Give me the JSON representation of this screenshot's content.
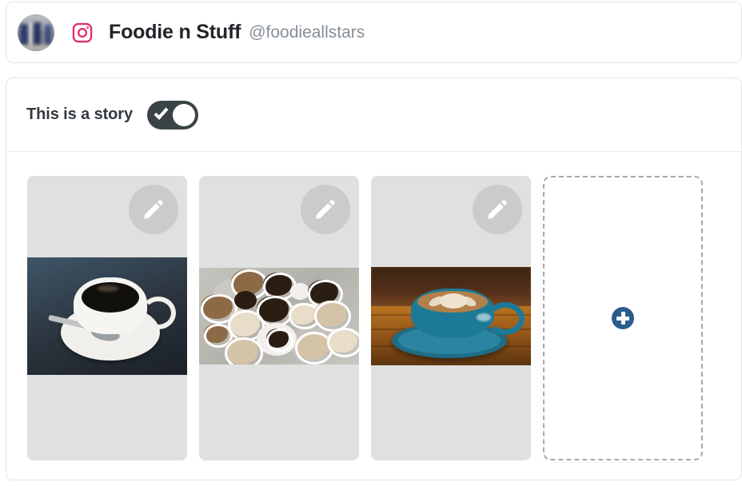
{
  "account": {
    "avatar_icon": "avatar-photo",
    "platform_icon": "instagram-icon",
    "platform": "Instagram",
    "name": "Foodie n Stuff",
    "handle": "@foodieallstars"
  },
  "story": {
    "title": "This is a story",
    "toggle": {
      "icon": "check-icon",
      "state": "on",
      "on_color": "#3a4447",
      "knob_color": "#ffffff"
    },
    "media": [
      {
        "index": 1,
        "edit_icon": "pencil-icon",
        "edit_label": "Edit",
        "alt": "Cup of black coffee with spoon on saucer"
      },
      {
        "index": 2,
        "edit_icon": "pencil-icon",
        "edit_label": "Edit",
        "alt": "Flat lay of many coffee cups on concrete"
      },
      {
        "index": 3,
        "edit_icon": "pencil-icon",
        "edit_label": "Edit",
        "alt": "Teal cup of latte with latte art on wooden table"
      }
    ],
    "add_card": {
      "icon": "plus-circle-icon",
      "label": "Add",
      "accent_color": "#2b5d8c"
    }
  },
  "colors": {
    "card_border": "#e4e6e8",
    "media_bg": "#dfe0e0",
    "edit_btn_bg": "#cacbcb",
    "instagram_pink": "#e1306c",
    "title_text": "#212529",
    "handle_text": "#868e96"
  }
}
